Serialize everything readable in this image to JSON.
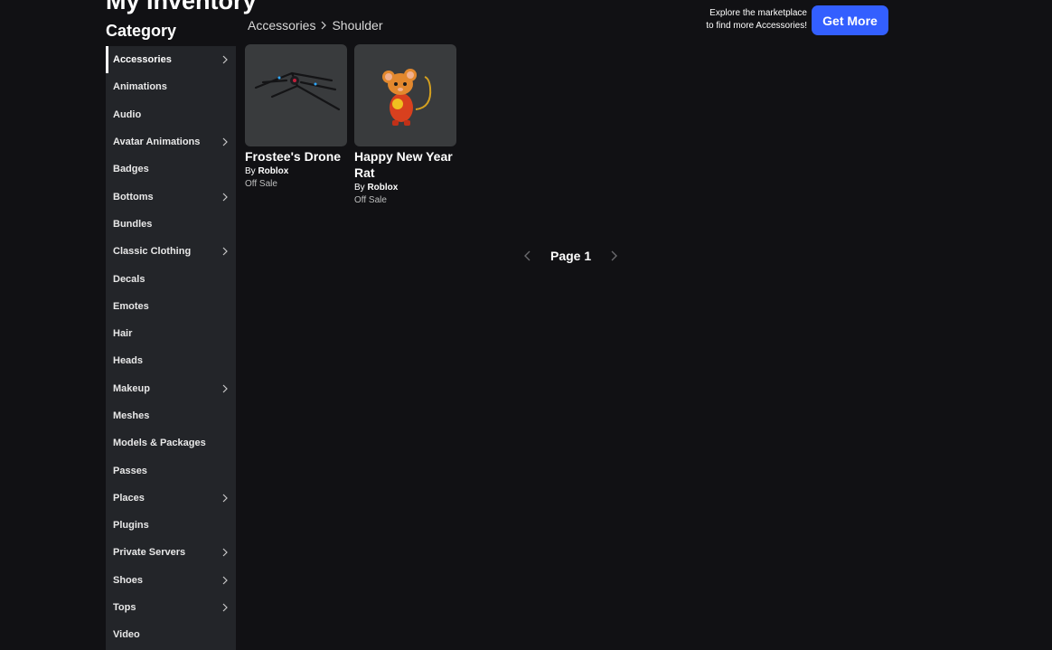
{
  "page": {
    "title": "My Inventory"
  },
  "sidebar": {
    "heading": "Category",
    "items": [
      {
        "label": "Accessories",
        "has_submenu": true,
        "active": true
      },
      {
        "label": "Animations",
        "has_submenu": false
      },
      {
        "label": "Audio",
        "has_submenu": false
      },
      {
        "label": "Avatar Animations",
        "has_submenu": true
      },
      {
        "label": "Badges",
        "has_submenu": false
      },
      {
        "label": "Bottoms",
        "has_submenu": true
      },
      {
        "label": "Bundles",
        "has_submenu": false
      },
      {
        "label": "Classic Clothing",
        "has_submenu": true
      },
      {
        "label": "Decals",
        "has_submenu": false
      },
      {
        "label": "Emotes",
        "has_submenu": false
      },
      {
        "label": "Hair",
        "has_submenu": false
      },
      {
        "label": "Heads",
        "has_submenu": false
      },
      {
        "label": "Makeup",
        "has_submenu": true
      },
      {
        "label": "Meshes",
        "has_submenu": false
      },
      {
        "label": "Models & Packages",
        "has_submenu": false
      },
      {
        "label": "Passes",
        "has_submenu": false
      },
      {
        "label": "Places",
        "has_submenu": true
      },
      {
        "label": "Plugins",
        "has_submenu": false
      },
      {
        "label": "Private Servers",
        "has_submenu": true
      },
      {
        "label": "Shoes",
        "has_submenu": true
      },
      {
        "label": "Tops",
        "has_submenu": true
      },
      {
        "label": "Video",
        "has_submenu": false
      }
    ]
  },
  "breadcrumb": {
    "parent": "Accessories",
    "current": "Shoulder"
  },
  "promo": {
    "line1": "Explore the marketplace",
    "line2": "to find more Accessories!",
    "button_label": "Get More",
    "button_color": "#335fff"
  },
  "items": [
    {
      "name": "Frostee's Drone",
      "by_prefix": "By",
      "creator": "Roblox",
      "status": "Off Sale",
      "thumb_icon": "drone-thumbnail"
    },
    {
      "name": "Happy New Year Rat",
      "by_prefix": "By",
      "creator": "Roblox",
      "status": "Off Sale",
      "thumb_icon": "rat-thumbnail"
    }
  ],
  "pagination": {
    "label": "Page 1"
  }
}
